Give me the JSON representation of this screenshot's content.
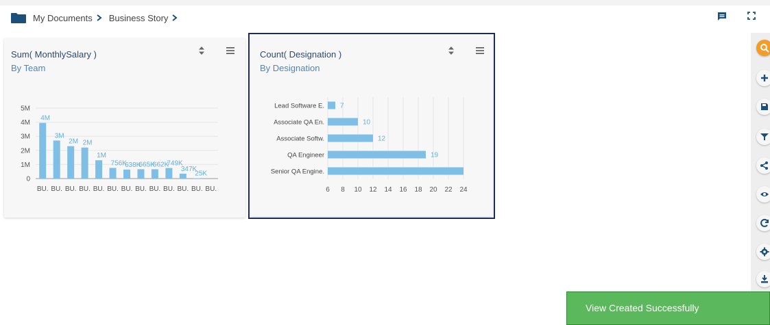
{
  "breadcrumb": {
    "items": [
      "My Documents",
      "Business Story"
    ]
  },
  "colors": {
    "bar": "#7fbfe5",
    "title": "#2b4a73",
    "subtitle": "#4f86b6",
    "toast": "#5cb85c",
    "accent": "#f39c2a"
  },
  "cards": [
    {
      "title": "Sum( MonthlySalary )",
      "subtitle": "By Team",
      "chart_data": {
        "type": "bar",
        "categories": [
          "BU.",
          "BU.",
          "BU.",
          "BU.",
          "BU.",
          "BU.",
          "BU.",
          "BU.",
          "BU.",
          "BU.",
          "BU.",
          "BU.",
          "BU."
        ],
        "values": [
          3950000,
          2700000,
          2300000,
          2200000,
          1300000,
          756000,
          638000,
          665000,
          662000,
          749000,
          347000,
          25000,
          0
        ],
        "data_labels": [
          "4M",
          "3M",
          "2M",
          "2M",
          "1M",
          "756K",
          "638K",
          "665K",
          "662K",
          "749K",
          "347K",
          "25K",
          ""
        ],
        "y_ticks": [
          "0",
          "1M",
          "2M",
          "3M",
          "4M",
          "5M"
        ],
        "ylim": [
          0,
          5000000
        ],
        "grid": true
      }
    },
    {
      "title": "Count( Designation )",
      "subtitle": "By Designation",
      "chart_data": {
        "type": "bar",
        "orientation": "horizontal",
        "categories": [
          "Lead Software E.",
          "Associate QA En.",
          "Associate Softw.",
          "QA Engineer",
          "Senior QA Engine."
        ],
        "values": [
          7,
          10,
          12,
          19,
          24
        ],
        "data_labels": [
          "7",
          "10",
          "12",
          "19",
          ""
        ],
        "x_ticks": [
          "6",
          "8",
          "10",
          "12",
          "14",
          "16",
          "18",
          "20",
          "22",
          "24"
        ],
        "xlim": [
          6,
          24
        ],
        "grid": true
      }
    }
  ],
  "sidebar": {
    "icons": [
      "search-icon",
      "plus-icon",
      "save-icon",
      "filter-icon",
      "share-icon",
      "eye-icon",
      "refresh-icon",
      "gear-icon",
      "export-icon"
    ]
  },
  "toast": {
    "message": "View Created Successfully"
  }
}
